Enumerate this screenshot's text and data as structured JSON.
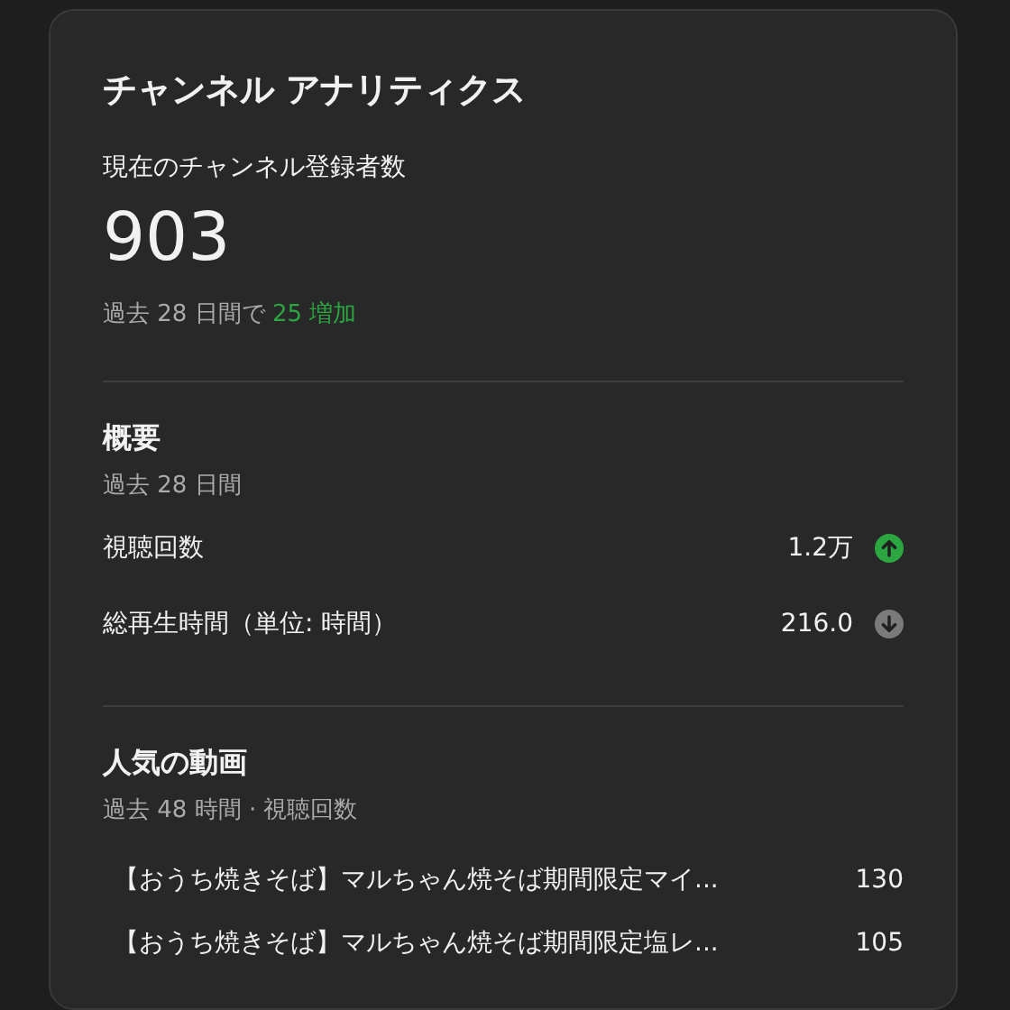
{
  "card": {
    "title": "チャンネル アナリティクス",
    "subscribers": {
      "label": "現在のチャンネル登録者数",
      "value": "903",
      "change_prefix": "過去 28 日間で",
      "change": "25 増加"
    },
    "summary": {
      "heading": "概要",
      "period": "過去 28 日間",
      "metrics": [
        {
          "label": "視聴回数",
          "value": "1.2万",
          "increase": true
        },
        {
          "label": "総再生時間（単位: 時間）",
          "value": "216.0",
          "increase": false
        }
      ]
    },
    "top_videos": {
      "heading": "人気の動画",
      "period": "過去 48 時間 · 視聴回数",
      "videos": [
        {
          "title": "【おうち焼きそば】マルちゃん焼そば期間限定マイ...",
          "views": "130"
        },
        {
          "title": "【おうち焼きそば】マルちゃん焼そば期間限定塩レ...",
          "views": "105"
        }
      ]
    }
  }
}
